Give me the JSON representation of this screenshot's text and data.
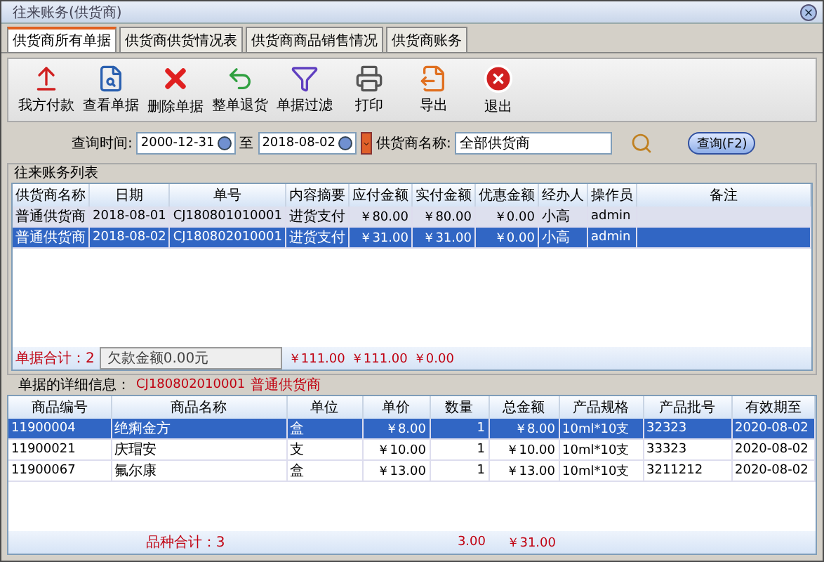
{
  "window": {
    "title": "往来账务(供货商)"
  },
  "tabs": [
    {
      "label": "供货商所有单据",
      "selected": true
    },
    {
      "label": "供货商供货情况表",
      "selected": false
    },
    {
      "label": "供货商商品销售情况",
      "selected": false
    },
    {
      "label": "供货商账务",
      "selected": false
    }
  ],
  "toolbar": {
    "buttons": [
      "我方付款",
      "查看单据",
      "删除单据",
      "整单退货",
      "单据过滤",
      "打印",
      "导出",
      "退出"
    ]
  },
  "query": {
    "time_label": "查询时间:",
    "date_from": "2000-12-31",
    "to_label": "至",
    "date_to": "2018-08-02",
    "supplier_label": "供货商名称:",
    "supplier": "全部供货商",
    "button": "查询(F2)"
  },
  "list": {
    "title": "往来账务列表",
    "columns": [
      "供货商名称",
      "日期",
      "单号",
      "内容摘要",
      "应付金额",
      "实付金额",
      "优惠金额",
      "经办人",
      "操作员",
      "备注"
    ],
    "rows": [
      {
        "selected": false,
        "cells": [
          "普通供货商",
          "2018-08-01",
          "CJ180801010001",
          "进货支付",
          "￥80.00",
          "￥80.00",
          "￥0.00",
          "小高",
          "admin",
          ""
        ]
      },
      {
        "selected": true,
        "cells": [
          "普通供货商",
          "2018-08-02",
          "CJ180802010001",
          "进货支付",
          "￥31.00",
          "￥31.00",
          "￥0.00",
          "小高",
          "admin",
          ""
        ]
      }
    ],
    "totals": {
      "count": "单据合计：2",
      "debt": "欠款金额0.00元",
      "payable": "￥111.00",
      "paid": "￥111.00",
      "discount": "￥0.00"
    }
  },
  "detail": {
    "label": "单据的详细信息：",
    "doc_no": "CJ180802010001",
    "supplier": "普通供货商",
    "columns": [
      "商品编号",
      "商品名称",
      "单位",
      "单价",
      "数量",
      "总金额",
      "产品规格",
      "产品批号",
      "有效期至"
    ],
    "rows": [
      {
        "selected": true,
        "cells": [
          "11900004",
          "绝痢金方",
          "盒",
          "￥8.00",
          "1",
          "￥8.00",
          "10ml*10支",
          "32323",
          "2020-08-02"
        ]
      },
      {
        "selected": false,
        "cells": [
          "11900021",
          "庆瑁安",
          "支",
          "￥10.00",
          "1",
          "￥10.00",
          "10ml*10支",
          "33323",
          "2020-08-02"
        ]
      },
      {
        "selected": false,
        "cells": [
          "11900067",
          "氟尔康",
          "盒",
          "￥13.00",
          "1",
          "￥13.00",
          "10ml*10支",
          "3211212",
          "2020-08-02"
        ]
      }
    ],
    "totals": {
      "count": "品种合计：3",
      "quantity": "3.00",
      "amount": "￥31.00"
    }
  }
}
